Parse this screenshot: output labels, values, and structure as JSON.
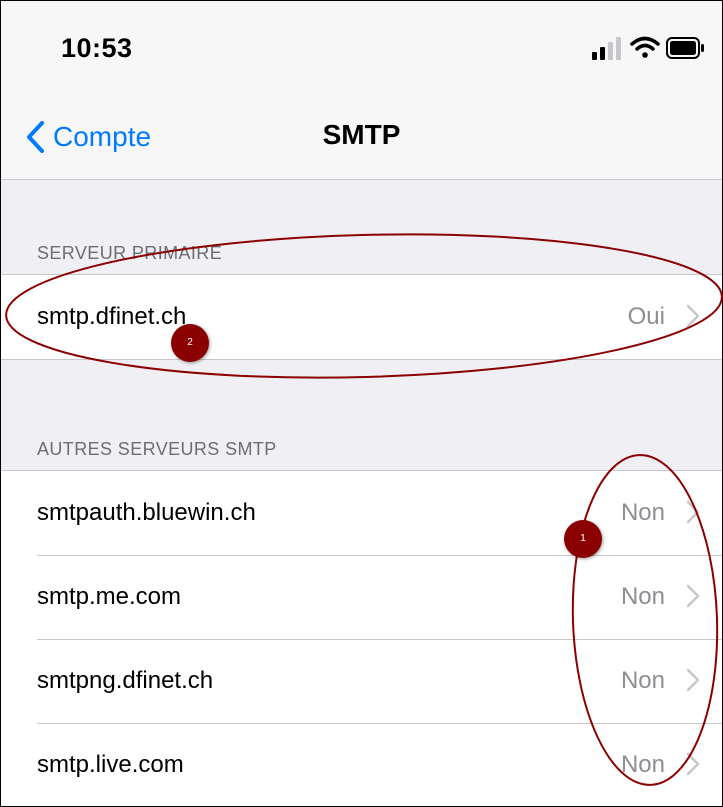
{
  "status_bar": {
    "time": "10:53",
    "icons": [
      "signal-icon",
      "wifi-icon",
      "battery-icon"
    ]
  },
  "nav": {
    "back_label": "Compte",
    "title": "SMTP"
  },
  "primary": {
    "header": "SERVEUR PRIMAIRE",
    "rows": [
      {
        "label": "smtp.dfinet.ch",
        "value": "Oui"
      }
    ]
  },
  "others": {
    "header": "AUTRES SERVEURS SMTP",
    "rows": [
      {
        "label": "smtpauth.bluewin.ch",
        "value": "Non"
      },
      {
        "label": "smtp.me.com",
        "value": "Non"
      },
      {
        "label": "smtpng.dfinet.ch",
        "value": "Non"
      },
      {
        "label": "smtp.live.com",
        "value": "Non"
      }
    ]
  },
  "annotations": {
    "marker_primary": "2",
    "marker_others": "1",
    "color": "#8b0000"
  },
  "colors": {
    "accent": "#007aff",
    "secondary_text": "#8e8e93",
    "background": "#efeff4"
  }
}
